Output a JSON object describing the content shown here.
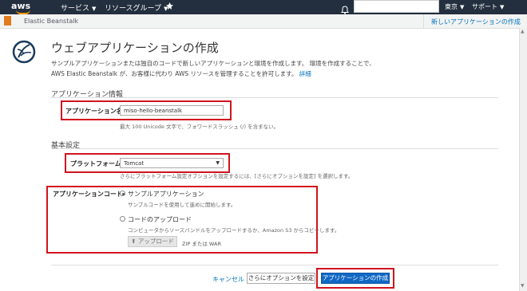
{
  "topnav": {
    "logo": "aws",
    "services": "サービス",
    "resource_groups": "リソースグループ",
    "pin_icon": "pin-icon",
    "bell_icon": "bell-icon",
    "region": "東京",
    "support": "サポート"
  },
  "subheader": {
    "service_name": "Elastic Beanstalk",
    "new_app_link": "新しいアプリケーションの作成"
  },
  "page": {
    "title": "ウェブアプリケーションの作成",
    "intro": "サンプルアプリケーションまたは独自のコードで新しいアプリケーションと環境を作成します。 環境を作成することで、AWS Elastic Beanstalk が、お客様に代わり AWS リソースを管理することを許可します。",
    "intro_link": "詳細"
  },
  "app_info": {
    "section_title": "アプリケーション情報",
    "name_label": "アプリケーション名",
    "name_value": "miso-hello-beanstalk",
    "name_hint": "最大 100 Unicode 文字で、フォワードスラッシュ (/) を含まない。"
  },
  "basic": {
    "section_title": "基本設定",
    "platform_label": "プラットフォーム",
    "platform_value": "Tomcat",
    "platform_hint": "さらにプラットフォーム設定オプションを設定するには、[さらにオプションを設定] を選択します。",
    "code_label": "アプリケーションコード",
    "option_sample": "サンプルアプリケーション",
    "option_sample_hint": "サンプルコードを使用して進めに開始します。",
    "option_upload": "コードのアップロード",
    "option_upload_hint": "コンピュータからソースバンドルをアップロードするか、Amazon S3 からコピーします。",
    "upload_button": "アップロード",
    "upload_note": "ZIP または WAR"
  },
  "footer": {
    "cancel": "キャンセル",
    "more_options": "さらにオプションを設定",
    "create": "アプリケーションの作成"
  },
  "colors": {
    "nav_bg": "#232f3e",
    "aws_orange": "#ff9900",
    "link_blue": "#0073bb",
    "primary_blue": "#1168c4",
    "highlight_red": "#d0141f"
  }
}
